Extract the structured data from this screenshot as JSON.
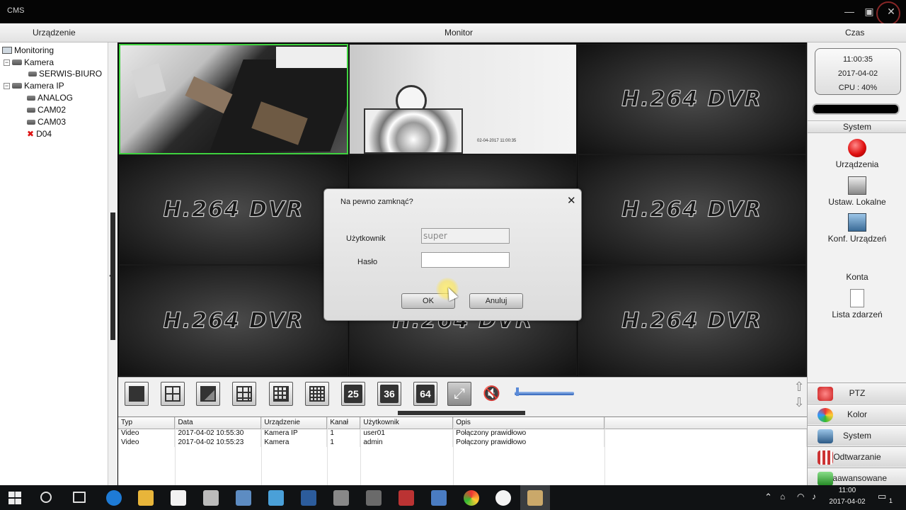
{
  "window": {
    "title": "CMS"
  },
  "menu": {
    "device": "Urządzenie",
    "monitor": "Monitor",
    "time": "Czas"
  },
  "tree": {
    "root": "Monitoring",
    "groups": [
      {
        "label": "Kamera",
        "children": [
          "SERWIS-BIURO"
        ]
      },
      {
        "label": "Kamera IP",
        "children": [
          "ANALOG",
          "CAM02",
          "CAM03",
          "D04"
        ]
      }
    ]
  },
  "grid": {
    "logo_text": "H.264 DVR",
    "cam2_timestamp": "02-04-2017 11:00:35"
  },
  "dialog": {
    "title": "Na pewno zamknąć?",
    "user_label": "Użytkownik",
    "user_value": "super",
    "password_label": "Hasło",
    "password_value": "",
    "ok_label": "OK",
    "cancel_label": "Anuluj"
  },
  "clock": {
    "time": "11:00:35",
    "date": "2017-04-02",
    "cpu": "CPU : 40%"
  },
  "right_panel": {
    "section": "System",
    "items": [
      "Urządzenia",
      "Ustaw. Lokalne",
      "Konf. Urządzeń",
      "Konta",
      "Lista zdarzeń"
    ],
    "buttons": [
      "PTZ",
      "Kolor",
      "System",
      "Odtwarzanie",
      "Zaawansowane"
    ]
  },
  "toolbar": {
    "layouts": [
      "25",
      "36",
      "64"
    ],
    "volume_level": 0.02
  },
  "log": {
    "headers": [
      "Typ",
      "Data",
      "Urządzenie",
      "Kanał",
      "Użytkownik",
      "Opis"
    ],
    "rows": [
      [
        "Video",
        "2017-04-02 10:55:30",
        "Kamera IP",
        "1",
        "user01",
        "Połączony prawidłowo"
      ],
      [
        "Video",
        "2017-04-02 10:55:23",
        "Kamera",
        "1",
        "admin",
        "Połączony prawidłowo"
      ]
    ]
  },
  "taskbar": {
    "time": "11:00",
    "date": "2017-04-02",
    "notifications": "1"
  }
}
